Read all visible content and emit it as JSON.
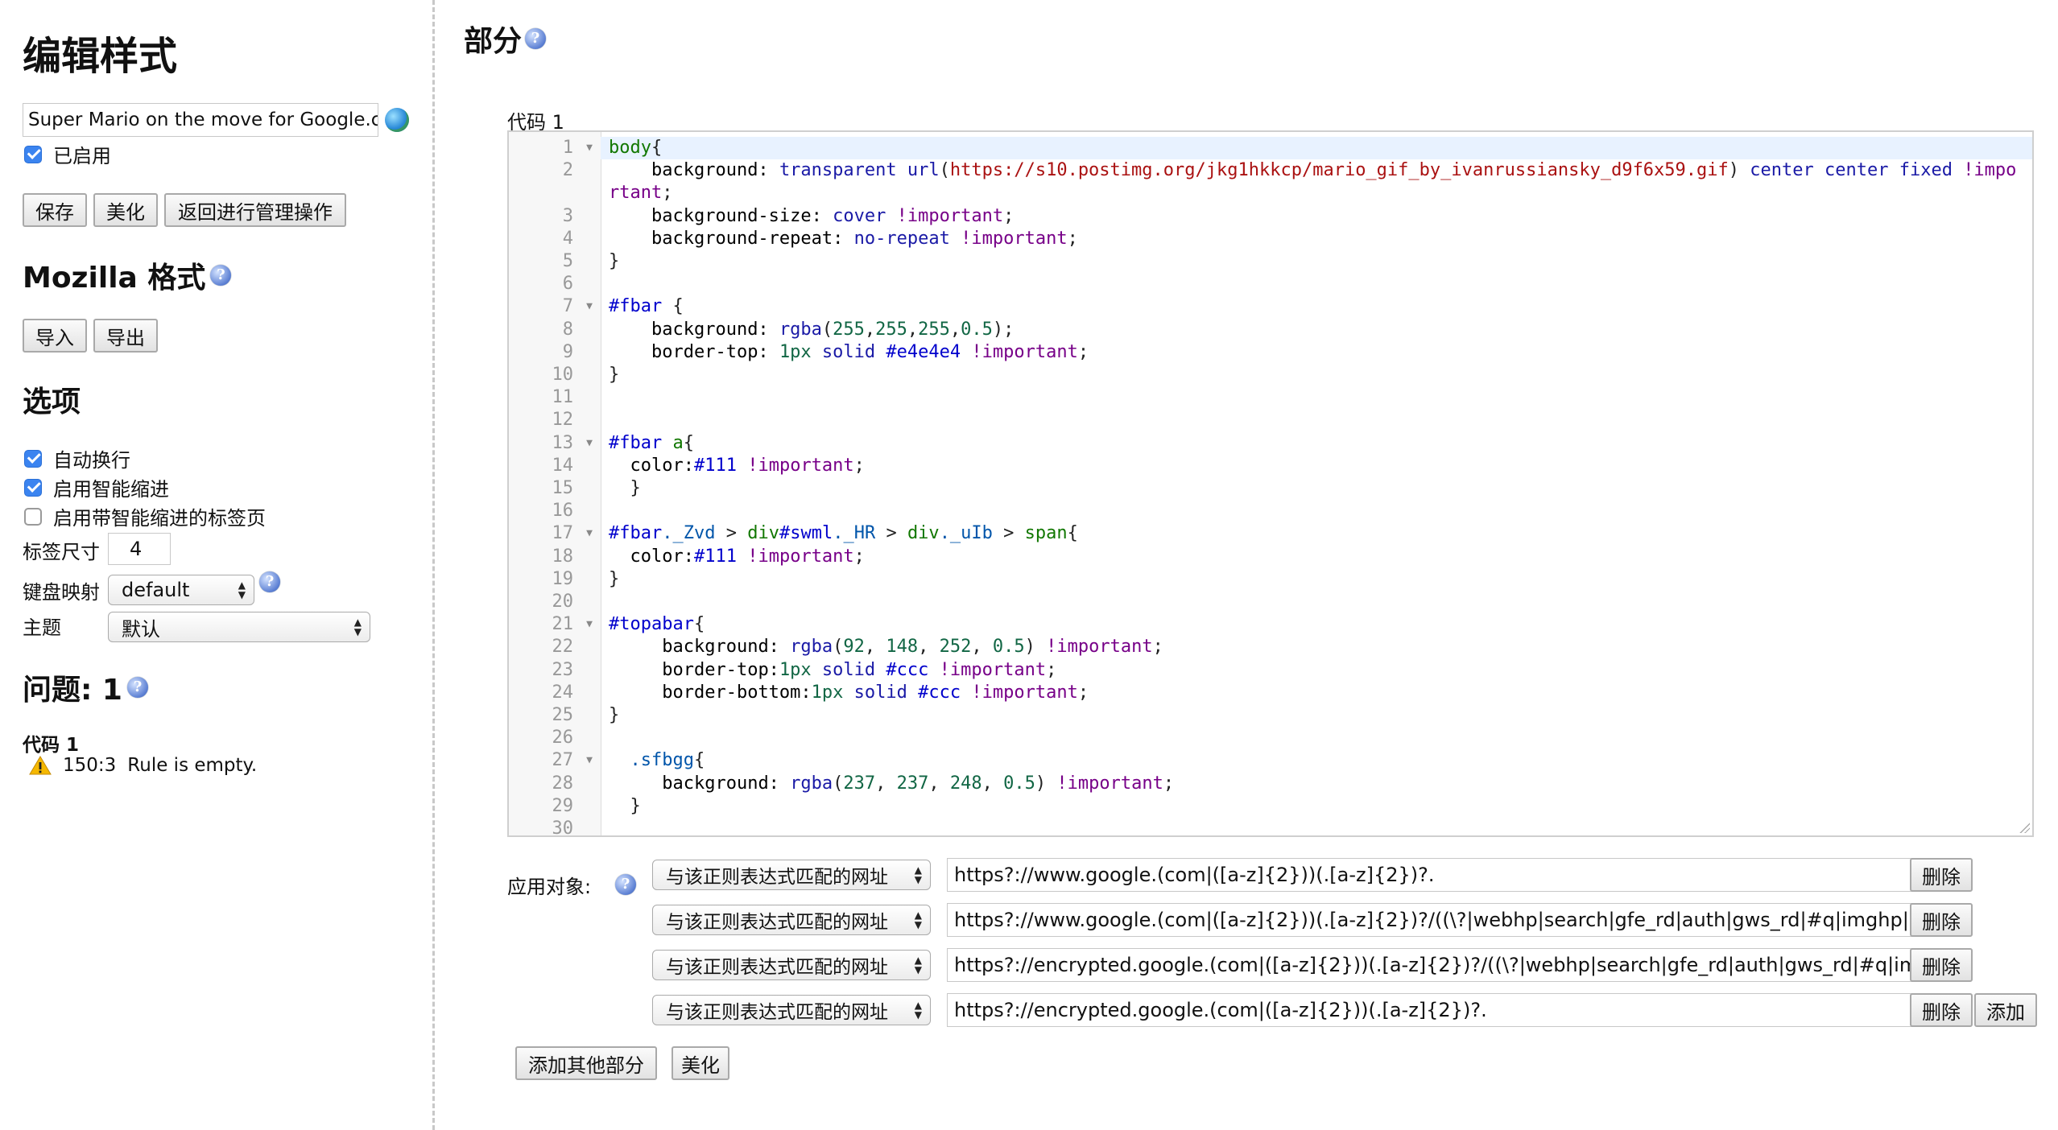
{
  "sidebar": {
    "title": "编辑样式",
    "style_name": "Super Mario on the move for Google.c",
    "enabled_label": "已启用",
    "buttons": {
      "save": "保存",
      "beautify": "美化",
      "back": "返回进行管理操作"
    },
    "mozilla_title": "Mozilla 格式",
    "mozilla_buttons": {
      "import": "导入",
      "export": "导出"
    },
    "options_title": "选项",
    "options": {
      "word_wrap": "自动换行",
      "smart_indent": "启用智能缩进",
      "tab_smart_indent": "启用带智能缩进的标签页"
    },
    "tab_size_label": "标签尺寸",
    "tab_size_value": "4",
    "keymap_label": "键盘映射",
    "keymap_value": "default",
    "theme_label": "主题",
    "theme_value": "默认",
    "issues_title": "问题: 1",
    "issue_section": "代码 1",
    "issue_position": "150:3",
    "issue_message": "Rule is empty."
  },
  "main": {
    "title": "部分",
    "code_label": "代码 1",
    "apply_label": "应用对象:",
    "rules": [
      {
        "type": "与该正则表达式匹配的网址",
        "value": "https?://www.google.(com|([a-z]{2}))(.[a-z]{2})?.",
        "delete": "删除"
      },
      {
        "type": "与该正则表达式匹配的网址",
        "value": "https?://www.google.(com|([a-z]{2}))(.[a-z]{2})?/((\\?|webhp|search|gfe_rd|auth|gws_rd|#q|imghp|#gfe_",
        "delete": "删除"
      },
      {
        "type": "与该正则表达式匹配的网址",
        "value": "https?://encrypted.google.(com|([a-z]{2}))(.[a-z]{2})?/((\\?|webhp|search|gfe_rd|auth|gws_rd|#q|imghp|",
        "delete": "删除"
      },
      {
        "type": "与该正则表达式匹配的网址",
        "value": "https?://encrypted.google.(com|([a-z]{2}))(.[a-z]{2})?.",
        "delete": "删除"
      }
    ],
    "add_label": "添加",
    "add_section": "添加其他部分",
    "beautify": "美化",
    "code_lines": [
      {
        "n": "1",
        "fold": true,
        "active": true,
        "tokens": [
          [
            "tag",
            "body"
          ],
          [
            "",
            "{"
          ]
        ]
      },
      {
        "n": "2",
        "tokens": [
          [
            "",
            "    "
          ],
          [
            "prop",
            "background: "
          ],
          [
            "val",
            "transparent url"
          ],
          [
            "",
            "("
          ],
          [
            "str",
            "https://s10.postimg.org/jkg1hkkcp/mario_gif_by_ivanrussiansky_d9f6x59.gif"
          ],
          [
            "",
            ") "
          ],
          [
            "val",
            "center center fixed "
          ],
          [
            "imp",
            "!important"
          ],
          [
            "",
            ";"
          ]
        ]
      },
      {
        "n": "3",
        "tokens": [
          [
            "",
            "    "
          ],
          [
            "prop",
            "background-size: "
          ],
          [
            "val",
            "cover "
          ],
          [
            "imp",
            "!important"
          ],
          [
            "",
            ";"
          ]
        ]
      },
      {
        "n": "4",
        "tokens": [
          [
            "",
            "    "
          ],
          [
            "prop",
            "background-repeat: "
          ],
          [
            "val",
            "no-repeat "
          ],
          [
            "imp",
            "!important"
          ],
          [
            "",
            ";"
          ]
        ]
      },
      {
        "n": "5",
        "tokens": [
          [
            "",
            "}"
          ]
        ]
      },
      {
        "n": "6",
        "tokens": []
      },
      {
        "n": "7",
        "fold": true,
        "tokens": [
          [
            "id",
            "#fbar"
          ],
          [
            "",
            " {"
          ]
        ]
      },
      {
        "n": "8",
        "tokens": [
          [
            "",
            "    "
          ],
          [
            "prop",
            "background: "
          ],
          [
            "val",
            "rgba"
          ],
          [
            "",
            "("
          ],
          [
            "num",
            "255"
          ],
          [
            "",
            ","
          ],
          [
            "num",
            "255"
          ],
          [
            "",
            ","
          ],
          [
            "num",
            "255"
          ],
          [
            "",
            ","
          ],
          [
            "num",
            "0.5"
          ],
          [
            "",
            ");"
          ]
        ]
      },
      {
        "n": "9",
        "tokens": [
          [
            "",
            "    "
          ],
          [
            "prop",
            "border-top: "
          ],
          [
            "num",
            "1px "
          ],
          [
            "val",
            "solid "
          ],
          [
            "id",
            "#e4e4e4 "
          ],
          [
            "imp",
            "!important"
          ],
          [
            "",
            ";"
          ]
        ]
      },
      {
        "n": "10",
        "tokens": [
          [
            "",
            "}"
          ]
        ]
      },
      {
        "n": "11",
        "tokens": []
      },
      {
        "n": "12",
        "tokens": []
      },
      {
        "n": "13",
        "fold": true,
        "tokens": [
          [
            "id",
            "#fbar "
          ],
          [
            "tag",
            "a"
          ],
          [
            "",
            "{"
          ]
        ]
      },
      {
        "n": "14",
        "tokens": [
          [
            "",
            "  "
          ],
          [
            "prop",
            "color:"
          ],
          [
            "id",
            "#111 "
          ],
          [
            "imp",
            "!important"
          ],
          [
            "",
            ";"
          ]
        ]
      },
      {
        "n": "15",
        "tokens": [
          [
            "",
            "  }"
          ]
        ]
      },
      {
        "n": "16",
        "tokens": []
      },
      {
        "n": "17",
        "fold": true,
        "tokens": [
          [
            "id",
            "#fbar"
          ],
          [
            "cls",
            "._Zvd "
          ],
          [
            "",
            ">"
          ],
          [
            "",
            " "
          ],
          [
            "tag",
            "div"
          ],
          [
            "id",
            "#swml"
          ],
          [
            "cls",
            "._HR "
          ],
          [
            "",
            ">"
          ],
          [
            "",
            " "
          ],
          [
            "tag",
            "div"
          ],
          [
            "cls",
            "._uIb "
          ],
          [
            "",
            ">"
          ],
          [
            "",
            " "
          ],
          [
            "tag",
            "span"
          ],
          [
            "",
            "{"
          ]
        ]
      },
      {
        "n": "18",
        "tokens": [
          [
            "",
            "  "
          ],
          [
            "prop",
            "color:"
          ],
          [
            "id",
            "#111 "
          ],
          [
            "imp",
            "!important"
          ],
          [
            "",
            ";"
          ]
        ]
      },
      {
        "n": "19",
        "tokens": [
          [
            "",
            "}"
          ]
        ]
      },
      {
        "n": "20",
        "tokens": []
      },
      {
        "n": "21",
        "fold": true,
        "tokens": [
          [
            "id",
            "#topabar"
          ],
          [
            "",
            "{"
          ]
        ]
      },
      {
        "n": "22",
        "tokens": [
          [
            "",
            "     "
          ],
          [
            "prop",
            "background: "
          ],
          [
            "val",
            "rgba"
          ],
          [
            "",
            "("
          ],
          [
            "num",
            "92"
          ],
          [
            "",
            ", "
          ],
          [
            "num",
            "148"
          ],
          [
            "",
            ", "
          ],
          [
            "num",
            "252"
          ],
          [
            "",
            ", "
          ],
          [
            "num",
            "0.5"
          ],
          [
            "",
            ") "
          ],
          [
            "imp",
            "!important"
          ],
          [
            "",
            ";"
          ]
        ]
      },
      {
        "n": "23",
        "tokens": [
          [
            "",
            "     "
          ],
          [
            "prop",
            "border-top:"
          ],
          [
            "num",
            "1px "
          ],
          [
            "val",
            "solid "
          ],
          [
            "id",
            "#ccc "
          ],
          [
            "imp",
            "!important"
          ],
          [
            "",
            ";"
          ]
        ]
      },
      {
        "n": "24",
        "tokens": [
          [
            "",
            "     "
          ],
          [
            "prop",
            "border-bottom:"
          ],
          [
            "num",
            "1px "
          ],
          [
            "val",
            "solid "
          ],
          [
            "id",
            "#ccc "
          ],
          [
            "imp",
            "!important"
          ],
          [
            "",
            ";"
          ]
        ]
      },
      {
        "n": "25",
        "tokens": [
          [
            "",
            "}"
          ]
        ]
      },
      {
        "n": "26",
        "tokens": []
      },
      {
        "n": "27",
        "fold": true,
        "tokens": [
          [
            "",
            "  "
          ],
          [
            "cls",
            ".sfbgg"
          ],
          [
            "",
            "{"
          ]
        ]
      },
      {
        "n": "28",
        "tokens": [
          [
            "",
            "     "
          ],
          [
            "prop",
            "background: "
          ],
          [
            "val",
            "rgba"
          ],
          [
            "",
            "("
          ],
          [
            "num",
            "237"
          ],
          [
            "",
            ", "
          ],
          [
            "num",
            "237"
          ],
          [
            "",
            ", "
          ],
          [
            "num",
            "248"
          ],
          [
            "",
            ", "
          ],
          [
            "num",
            "0.5"
          ],
          [
            "",
            ") "
          ],
          [
            "imp",
            "!important"
          ],
          [
            "",
            ";"
          ]
        ]
      },
      {
        "n": "29",
        "tokens": [
          [
            "",
            "  }"
          ]
        ]
      },
      {
        "n": "30",
        "tokens": []
      }
    ]
  }
}
